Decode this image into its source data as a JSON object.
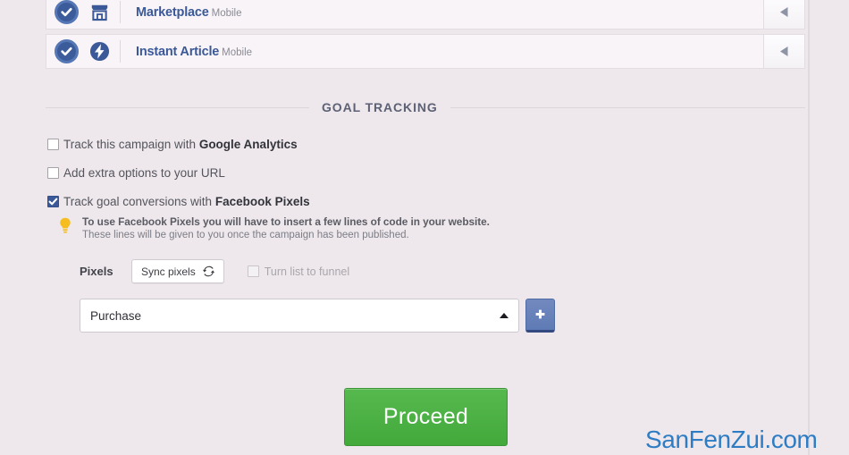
{
  "placements": {
    "rows": [
      {
        "name": "Marketplace",
        "platform": "Mobile",
        "icon": "storefront-icon",
        "checked": true,
        "collapse_icon": "triangle-left-icon"
      },
      {
        "name": "Instant Article",
        "platform": "Mobile",
        "icon": "lightning-bolt-icon",
        "checked": true,
        "collapse_icon": "triangle-left-icon"
      }
    ]
  },
  "goal_tracking": {
    "section_title": "GOAL TRACKING",
    "options": [
      {
        "text_prefix": "Track this campaign with ",
        "text_bold": "Google Analytics",
        "checked": false
      },
      {
        "text_prefix": "Add extra options to your URL",
        "text_bold": "",
        "checked": false
      },
      {
        "text_prefix": "Track goal conversions with ",
        "text_bold": "Facebook Pixels",
        "checked": true
      }
    ],
    "tip": {
      "icon": "lightbulb-icon",
      "title": "To use Facebook Pixels you will have to insert a few lines of code in your website.",
      "subtitle": "These lines will be given to you once the campaign has been published."
    },
    "pixels": {
      "label": "Pixels",
      "sync_button_label": "Sync pixels",
      "sync_button_icon": "sync-refresh-icon",
      "funnel_checkbox_label": "Turn list to funnel",
      "funnel_checkbox_checked": false,
      "funnel_checkbox_disabled": true,
      "select_value": "Purchase",
      "select_caret": "caret-up-icon",
      "add_button_label": "+"
    }
  },
  "footer": {
    "proceed_label": "Proceed",
    "watermark": "SanFenZui.com"
  },
  "colors": {
    "page_background": "#eee8ec",
    "row_background": "#f8f4f7",
    "brand_blue": "#3b5998",
    "accent_green": "#4aae42",
    "plus_blue": "#6d84b4",
    "watermark_blue": "#2e7dc4",
    "tip_yellow": "#f5bd1f"
  }
}
